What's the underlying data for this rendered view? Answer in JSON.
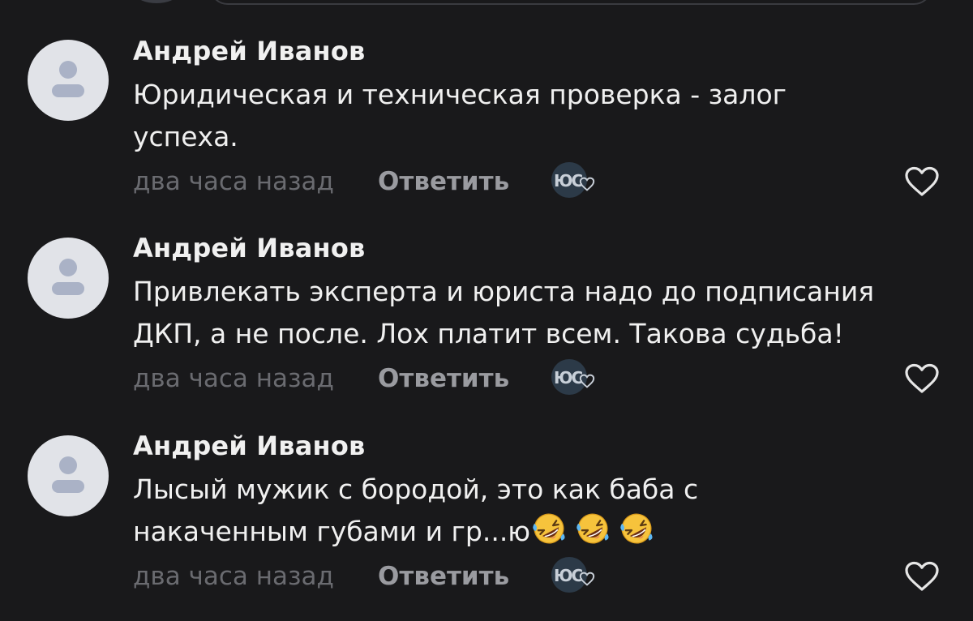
{
  "comments": [
    {
      "author": "Андрей Иванов",
      "lines": [
        "Юридическая и техническая проверка - залог",
        "успеха."
      ],
      "emoji_count": 0,
      "time": "два часа назад",
      "reply_label": "Ответить",
      "reaction_icon": "yc-logo-heart-icon",
      "like_icon": "heart-outline-icon"
    },
    {
      "author": "Андрей Иванов",
      "lines": [
        "Привлекать эксперта и юриста надо до подписания",
        "ДКП, а не после. Лох платит всем. Такова судьба!"
      ],
      "emoji_count": 0,
      "time": "два часа назад",
      "reply_label": "Ответить",
      "reaction_icon": "yc-logo-heart-icon",
      "like_icon": "heart-outline-icon"
    },
    {
      "author": "Андрей Иванов",
      "lines": [
        "Лысый мужик с бородой, это как баба с",
        "накаченным губами и гр...ю"
      ],
      "emoji": "🤣",
      "emoji_count": 3,
      "emoji_icon": "rolling-on-floor-laughing-emoji-icon",
      "time": "два часа назад",
      "reply_label": "Ответить",
      "reaction_icon": "yc-logo-heart-icon",
      "like_icon": "heart-outline-icon"
    }
  ],
  "reaction_badge_text": "ЮС",
  "colors": {
    "background": "#19191b",
    "text": "#f0f0f0",
    "muted": "#6a6b70",
    "reply": "#9a9ba0",
    "avatar_bg": "#e1e3e8",
    "avatar_fg": "#aab2c6"
  }
}
